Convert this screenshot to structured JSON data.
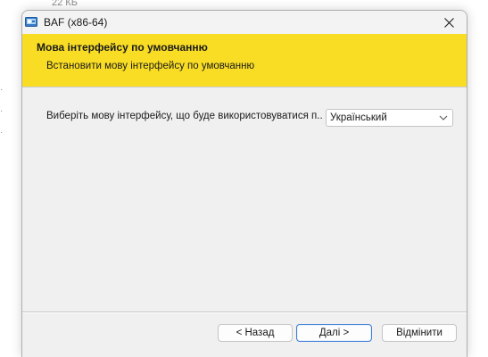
{
  "background": {
    "file_size": "22 КБ"
  },
  "window": {
    "title": "BAF (x86-64)",
    "close_icon": "close-icon",
    "app_icon": "installer-icon"
  },
  "banner": {
    "title": "Мова інтерфейсу по умовчанню",
    "subtitle": "Встановити мову інтерфейсу по умовчанню",
    "color": "#f9dd25"
  },
  "content": {
    "prompt": "Виберіть мову інтерфейсу, що буде використовуватися п...",
    "language_select": {
      "value": "Український"
    }
  },
  "footer": {
    "back_label": "< Назад",
    "next_label": "Далі >",
    "cancel_label": "Відмінити"
  }
}
